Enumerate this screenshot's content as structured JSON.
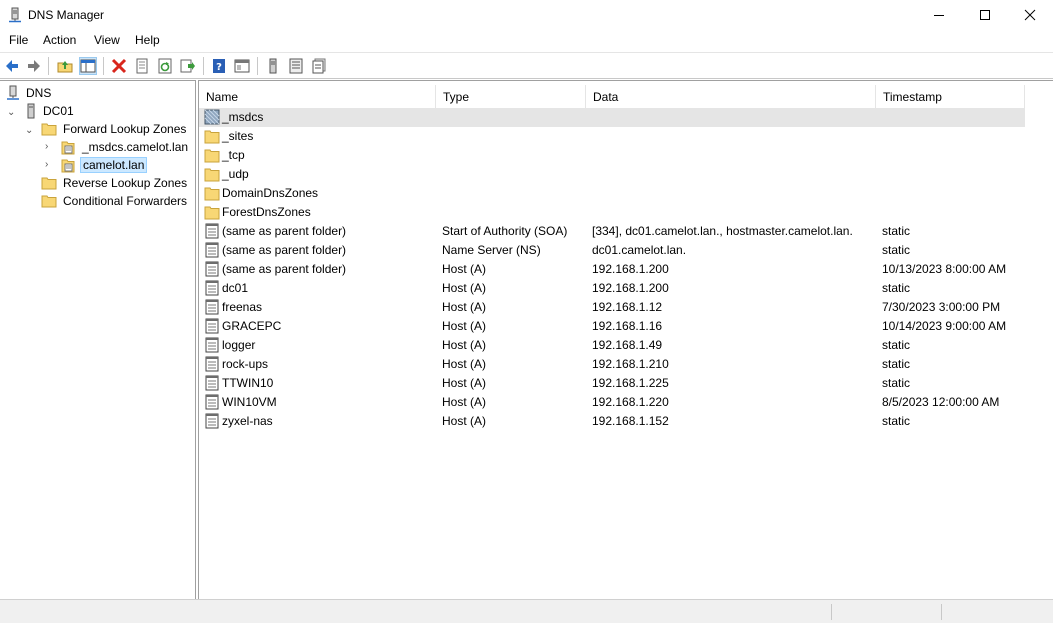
{
  "window": {
    "title": "DNS Manager",
    "controls": {
      "minimize": "minimize",
      "maximize": "maximize",
      "close": "close"
    }
  },
  "menu": [
    "File",
    "Action",
    "View",
    "Help"
  ],
  "toolbar": {
    "buttons": [
      "back-icon",
      "forward-icon",
      "up-folder-icon",
      "show-hide-tree-icon",
      "delete-icon",
      "properties-icon",
      "refresh-icon",
      "export-list-icon",
      "help-icon",
      "console-view-icon",
      "server-icon",
      "list-view-icon",
      "detail-view-icon"
    ]
  },
  "tree": {
    "root": "DNS",
    "server": "DC01",
    "forward_zones": "Forward Lookup Zones",
    "zone_msdcs": "_msdcs.camelot.lan",
    "zone_camelot": "camelot.lan",
    "reverse_zones": "Reverse Lookup Zones",
    "conditional_forwarders": "Conditional Forwarders"
  },
  "list": {
    "columns": [
      "Name",
      "Type",
      "Data",
      "Timestamp"
    ],
    "rows": [
      {
        "icon": "delegated-zone-icon",
        "name": "_msdcs",
        "type": "",
        "data": "",
        "timestamp": ""
      },
      {
        "icon": "folder-icon",
        "name": "_sites",
        "type": "",
        "data": "",
        "timestamp": ""
      },
      {
        "icon": "folder-icon",
        "name": "_tcp",
        "type": "",
        "data": "",
        "timestamp": ""
      },
      {
        "icon": "folder-icon",
        "name": "_udp",
        "type": "",
        "data": "",
        "timestamp": ""
      },
      {
        "icon": "folder-icon",
        "name": "DomainDnsZones",
        "type": "",
        "data": "",
        "timestamp": ""
      },
      {
        "icon": "folder-icon",
        "name": "ForestDnsZones",
        "type": "",
        "data": "",
        "timestamp": ""
      },
      {
        "icon": "record-icon",
        "name": "(same as parent folder)",
        "type": "Start of Authority (SOA)",
        "data": "[334], dc01.camelot.lan., hostmaster.camelot.lan.",
        "timestamp": "static"
      },
      {
        "icon": "record-icon",
        "name": "(same as parent folder)",
        "type": "Name Server (NS)",
        "data": "dc01.camelot.lan.",
        "timestamp": "static"
      },
      {
        "icon": "record-icon",
        "name": "(same as parent folder)",
        "type": "Host (A)",
        "data": "192.168.1.200",
        "timestamp": "10/13/2023 8:00:00 AM"
      },
      {
        "icon": "record-icon",
        "name": "dc01",
        "type": "Host (A)",
        "data": "192.168.1.200",
        "timestamp": "static"
      },
      {
        "icon": "record-icon",
        "name": "freenas",
        "type": "Host (A)",
        "data": "192.168.1.12",
        "timestamp": "7/30/2023 3:00:00 PM"
      },
      {
        "icon": "record-icon",
        "name": "GRACEPC",
        "type": "Host (A)",
        "data": "192.168.1.16",
        "timestamp": "10/14/2023 9:00:00 AM"
      },
      {
        "icon": "record-icon",
        "name": "logger",
        "type": "Host (A)",
        "data": "192.168.1.49",
        "timestamp": "static"
      },
      {
        "icon": "record-icon",
        "name": "rock-ups",
        "type": "Host (A)",
        "data": "192.168.1.210",
        "timestamp": "static"
      },
      {
        "icon": "record-icon",
        "name": "TTWIN10",
        "type": "Host (A)",
        "data": "192.168.1.225",
        "timestamp": "static"
      },
      {
        "icon": "record-icon",
        "name": "WIN10VM",
        "type": "Host (A)",
        "data": "192.168.1.220",
        "timestamp": "8/5/2023 12:00:00 AM"
      },
      {
        "icon": "record-icon",
        "name": "zyxel-nas",
        "type": "Host (A)",
        "data": "192.168.1.152",
        "timestamp": "static"
      }
    ]
  },
  "colors": {
    "selection": "#cce8ff",
    "folder": "#f8d775",
    "accent_blue": "#2a6fc9",
    "delete_red": "#d9261c"
  }
}
